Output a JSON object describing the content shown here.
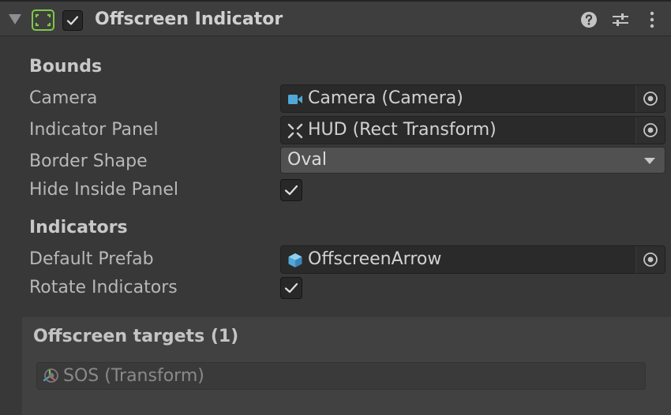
{
  "header": {
    "title": "Offscreen Indicator",
    "enabled": true,
    "icons": [
      "foldout-arrow-icon",
      "component-bounds-icon",
      "help-icon",
      "presets-icon",
      "kebab-menu-icon"
    ]
  },
  "bounds": {
    "heading": "Bounds",
    "camera": {
      "label": "Camera",
      "value": "Camera (Camera)",
      "icon": "camera-icon"
    },
    "indicator_panel": {
      "label": "Indicator Panel",
      "value": "HUD (Rect Transform)",
      "icon": "rect-transform-icon"
    },
    "border_shape": {
      "label": "Border Shape",
      "value": "Oval"
    },
    "hide_inside_panel": {
      "label": "Hide Inside Panel",
      "checked": true
    }
  },
  "indicators": {
    "heading": "Indicators",
    "default_prefab": {
      "label": "Default Prefab",
      "value": "OffscreenArrow",
      "icon": "prefab-cube-icon"
    },
    "rotate_indicators": {
      "label": "Rotate Indicators",
      "checked": true
    }
  },
  "targets": {
    "heading": "Offscreen targets (1)",
    "items": [
      {
        "value": "SOS (Transform)",
        "icon": "transform-icon"
      }
    ]
  },
  "colors": {
    "accent_green": "#7fc84a",
    "camera_blue": "#4fa8d8",
    "background": "#383838"
  }
}
